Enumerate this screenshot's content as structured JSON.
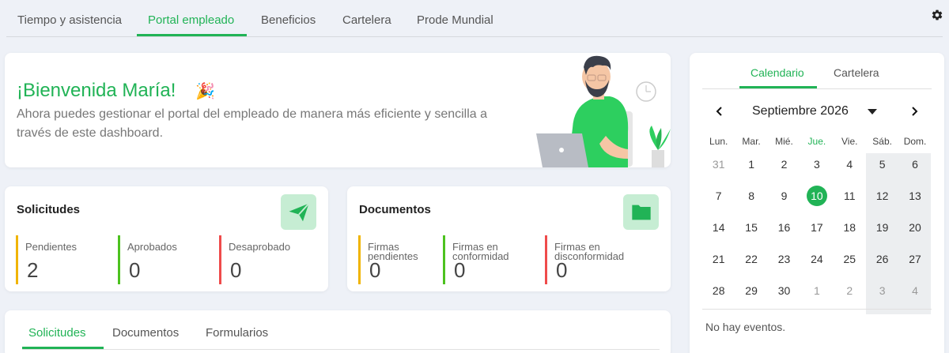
{
  "topnav": {
    "tabs": [
      {
        "label": "Tiempo y asistencia"
      },
      {
        "label": "Portal empleado"
      },
      {
        "label": "Beneficios"
      },
      {
        "label": "Cartelera"
      },
      {
        "label": "Prode Mundial"
      }
    ]
  },
  "welcome": {
    "title": "¡Bienvenida María!",
    "subtitle": "Ahora puedes gestionar el portal del empleado de manera más eficiente y sencilla a través de este dashboard.",
    "emoji": "🎉"
  },
  "solicitudes": {
    "title": "Solicitudes",
    "metrics": [
      {
        "label": "Pendientes",
        "value": "2",
        "color": "#f0b400"
      },
      {
        "label": "Aprobados",
        "value": "0",
        "color": "#4cc21f"
      },
      {
        "label": "Desaprobado",
        "value": "0",
        "color": "#ef4b4b"
      }
    ]
  },
  "documentos": {
    "title": "Documentos",
    "metrics": [
      {
        "label": "Firmas pendientes",
        "value": "0",
        "color": "#f0b400"
      },
      {
        "label": "Firmas en conformidad",
        "value": "0",
        "color": "#4cc21f"
      },
      {
        "label": "Firmas en disconformidad",
        "value": "0",
        "color": "#ef4b4b"
      }
    ]
  },
  "bottom_tabs": [
    {
      "label": "Solicitudes"
    },
    {
      "label": "Documentos"
    },
    {
      "label": "Formularios"
    }
  ],
  "calendar": {
    "tabs": [
      {
        "label": "Calendario"
      },
      {
        "label": "Cartelera"
      }
    ],
    "month": "Septiembre 2026",
    "prev": "‹",
    "next": "›",
    "weekdays": [
      "Lun.",
      "Mar.",
      "Mié.",
      "Jue.",
      "Vie.",
      "Sáb.",
      "Dom."
    ],
    "weeks": [
      [
        "31",
        "1",
        "2",
        "3",
        "4",
        "5",
        "6"
      ],
      [
        "7",
        "8",
        "9",
        "10",
        "11",
        "12",
        "13"
      ],
      [
        "14",
        "15",
        "16",
        "17",
        "18",
        "19",
        "20"
      ],
      [
        "21",
        "22",
        "23",
        "24",
        "25",
        "26",
        "27"
      ],
      [
        "28",
        "29",
        "30",
        "1",
        "2",
        "3",
        "4"
      ]
    ],
    "today": "10",
    "empty_text": "No hay eventos."
  },
  "colors": {
    "accent": "#21b356",
    "accent_light": "#c6edd3"
  }
}
